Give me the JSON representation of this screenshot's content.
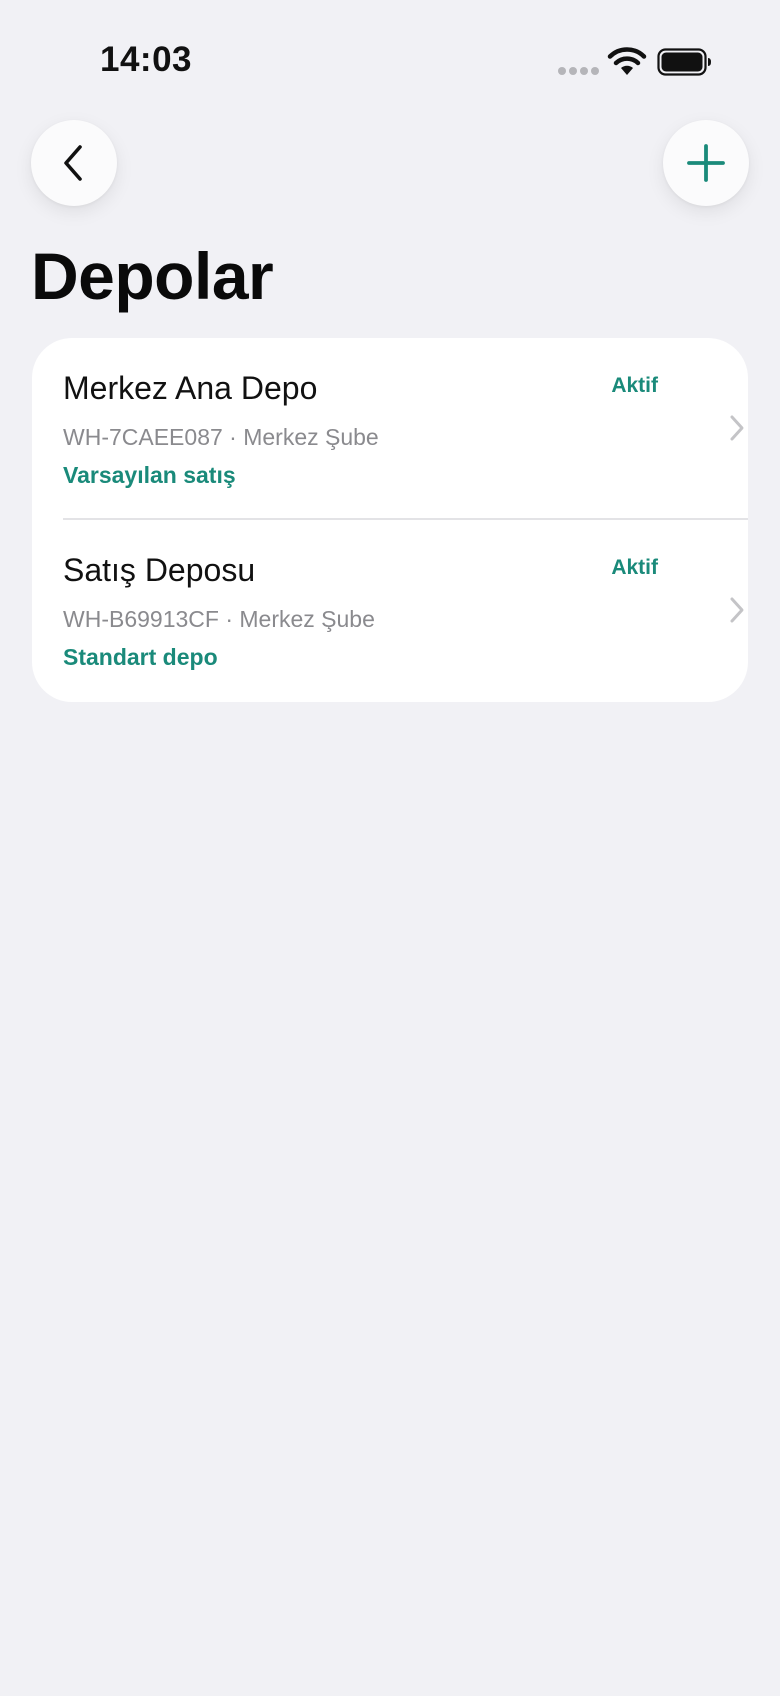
{
  "status_bar": {
    "time": "14:03"
  },
  "nav": {
    "back_icon": "chevron-left-icon",
    "add_icon": "plus-icon"
  },
  "page": {
    "title": "Depolar"
  },
  "warehouses": [
    {
      "name": "Merkez Ana Depo",
      "status": "Aktif",
      "code_branch": "WH-7CAEE087 · Merkez Şube",
      "type": "Varsayılan satış"
    },
    {
      "name": "Satış Deposu",
      "status": "Aktif",
      "code_branch": "WH-B69913CF · Merkez Şube",
      "type": "Standart depo"
    }
  ],
  "colors": {
    "background": "#f1f1f5",
    "card": "#ffffff",
    "accent": "#1a8a7a",
    "secondary_text": "#8a8a8e"
  }
}
